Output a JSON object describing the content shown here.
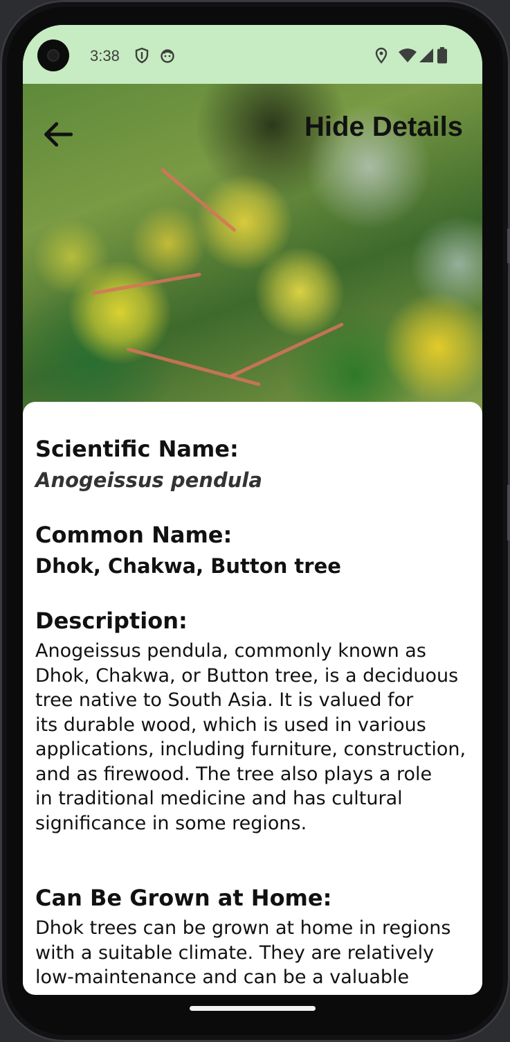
{
  "status_bar": {
    "time": "3:38",
    "left_icons": [
      "shield-icon",
      "face-icon"
    ],
    "right_icons": [
      "location-icon",
      "wifi-icon",
      "signal-icon",
      "battery-icon"
    ]
  },
  "header": {
    "back_icon": "arrow-left-icon",
    "hide_details_label": "Hide Details"
  },
  "plant": {
    "scientific_name_label": "Scientific Name:",
    "scientific_name": "Anogeissus pendula",
    "common_name_label": "Common Name:",
    "common_name": "Dhok, Chakwa, Button tree",
    "description_label": "Description:",
    "description_lines": [
      "Anogeissus pendula, commonly known as",
      "Dhok, Chakwa, or Button tree, is a deciduous",
      "tree native to South Asia. It is valued for",
      "its durable wood, which is used in various",
      "applications, including furniture, construction,",
      "and as firewood. The tree also plays a role",
      "in traditional medicine and has cultural",
      "significance in some regions."
    ],
    "home_label": "Can Be Grown at Home:",
    "home_lines": [
      "Dhok trees can be grown at home in regions",
      "with a suitable climate. They are relatively",
      "low-maintenance and can be a valuable"
    ]
  },
  "colors": {
    "status_bar_bg": "#c7ebc2",
    "sheet_bg": "#ffffff",
    "text": "#111111"
  }
}
